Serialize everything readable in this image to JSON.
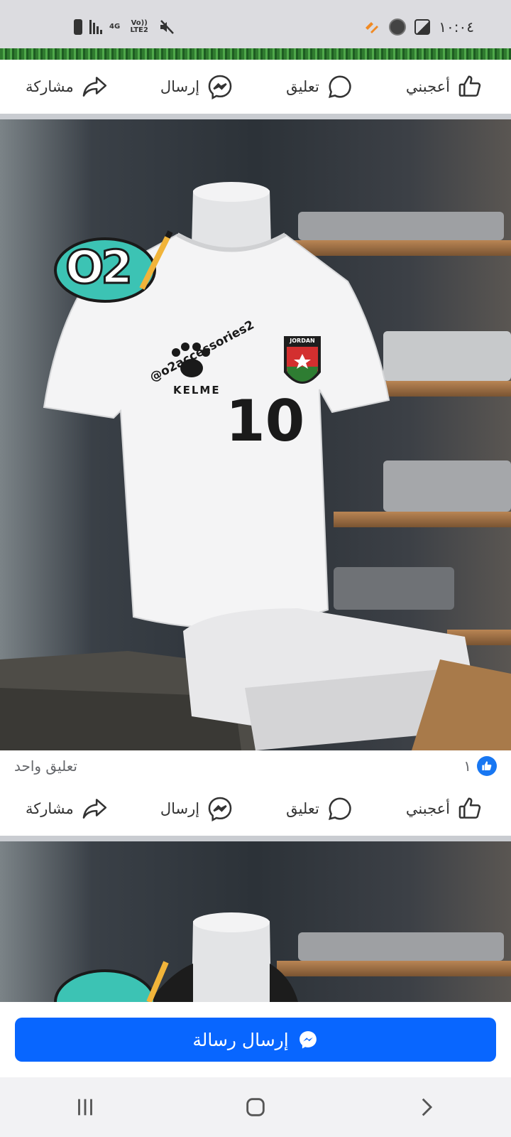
{
  "status_bar": {
    "time": "١٠:٠٤",
    "network_type": "4G",
    "volte": "Vo)) LTE2",
    "icons": [
      "battery-icon",
      "signal-icon",
      "mute-icon",
      "gallery-icon",
      "app-icon",
      "notification-icon"
    ]
  },
  "post_actions": {
    "like_label": "أعجبني",
    "comment_label": "تعليق",
    "send_label": "إرسال",
    "share_label": "مشاركة"
  },
  "post": {
    "like_count": "١",
    "comment_summary": "تعليق واحد",
    "image": {
      "logo_text": "O2",
      "brand_text": "KELME",
      "watermark": "@o2accessories2",
      "badge_text": "JORDAN",
      "shirt_number": "10"
    }
  },
  "send_message": {
    "label": "إرسال رسالة"
  },
  "colors": {
    "accent": "#0866ff",
    "like_badge": "#1877f2",
    "separator": "#c9ccd1",
    "status_bar": "#dcdce0"
  },
  "nav": {
    "icons": [
      "recent-apps-icon",
      "home-icon",
      "back-icon"
    ]
  }
}
